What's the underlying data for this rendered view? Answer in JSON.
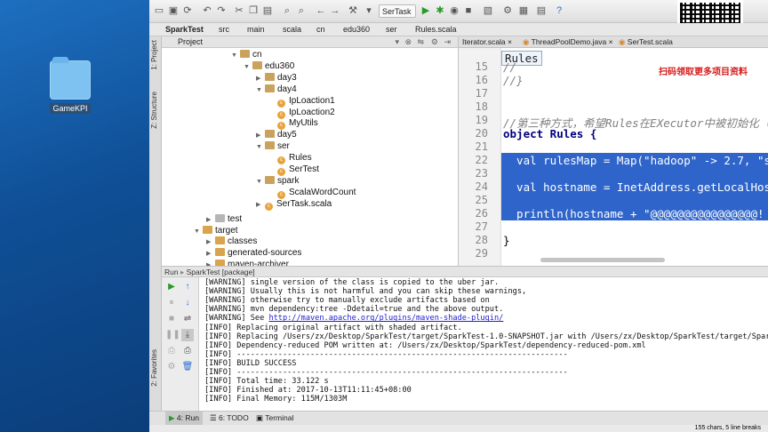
{
  "desktop": {
    "icon_label": "GameKPI"
  },
  "toolbar": {
    "run_config": "SerTask"
  },
  "overlay": {
    "qr_caption": "扫码领取更多项目资料"
  },
  "breadcrumb": [
    "SparkTest",
    "src",
    "main",
    "scala",
    "cn",
    "edu360",
    "ser",
    "Rules.scala"
  ],
  "editor_tabs": [
    "Iterator.scala",
    "ThreadPoolDemo.java",
    "SerTest.scala"
  ],
  "left_tabs": {
    "project": "1: Project",
    "structure": "Z: Structure",
    "favorites": "2: Favorites"
  },
  "project_panel": {
    "title": "Project"
  },
  "tree": [
    {
      "label": "cn",
      "kind": "folder",
      "arrow": "▼"
    },
    {
      "label": "edu360",
      "kind": "folder",
      "arrow": "▼"
    },
    {
      "label": "day3",
      "kind": "folder",
      "arrow": "▶"
    },
    {
      "label": "day4",
      "kind": "folder",
      "arrow": "▼"
    },
    {
      "label": "IpLoaction1",
      "kind": "class",
      "arrow": ""
    },
    {
      "label": "IpLoaction2",
      "kind": "class",
      "arrow": ""
    },
    {
      "label": "MyUtils",
      "kind": "class",
      "arrow": ""
    },
    {
      "label": "day5",
      "kind": "folder",
      "arrow": "▶"
    },
    {
      "label": "ser",
      "kind": "folder",
      "arrow": "▼"
    },
    {
      "label": "Rules",
      "kind": "class",
      "arrow": ""
    },
    {
      "label": "SerTest",
      "kind": "class",
      "arrow": ""
    },
    {
      "label": "spark",
      "kind": "folder",
      "arrow": "▼"
    },
    {
      "label": "ScalaWordCount",
      "kind": "class",
      "arrow": ""
    },
    {
      "label": "SerTask.scala",
      "kind": "class",
      "arrow": "▶"
    },
    {
      "label": "test",
      "kind": "src",
      "arrow": "▶"
    },
    {
      "label": "target",
      "kind": "tgt",
      "arrow": "▼"
    },
    {
      "label": "classes",
      "kind": "tgt",
      "arrow": "▶"
    },
    {
      "label": "generated-sources",
      "kind": "tgt",
      "arrow": "▶"
    },
    {
      "label": "maven-archiver",
      "kind": "tgt",
      "arrow": "▶"
    }
  ],
  "editor": {
    "popup": "Rules",
    "line_numbers": [
      "15",
      "16",
      "17",
      "18",
      "19",
      "20",
      "21",
      "22",
      "23",
      "24",
      "25",
      "26",
      "27",
      "28",
      "29"
    ],
    "lines": [
      "//",
      "//}",
      "",
      "",
      "//第三种方式，希望Rules在EXecutor中被初始化（不",
      "object Rules {",
      "",
      "  val rulesMap = Map(\"hadoop\" -> 2.7, \"s",
      "",
      "  val hostname = InetAddress.getLocalHos",
      "",
      "  println(hostname + \"@@@@@@@@@@@@@@@@! ",
      "",
      "}",
      ""
    ]
  },
  "run": {
    "header_label": "Run",
    "header_target": "SparkTest [package]"
  },
  "console": [
    "[WARNING] single version of the class is copied to the uber jar.",
    "[WARNING] Usually this is not harmful and you can skip these warnings,",
    "[WARNING] otherwise try to manually exclude artifacts based on",
    "[WARNING] mvn dependency:tree -Ddetail=true and the above output.",
    "[WARNING] See ",
    "[INFO] Replacing original artifact with shaded artifact.",
    "[INFO] Replacing /Users/zx/Desktop/SparkTest/target/SparkTest-1.0-SNAPSHOT.jar with /Users/zx/Desktop/SparkTest/target/SparkTest-1.0-SNAPSHOT-shaded.jar",
    "[INFO] Dependency-reduced POM written at: /Users/zx/Desktop/SparkTest/dependency-reduced-pom.xml",
    "[INFO] ------------------------------------------------------------------------",
    "[INFO] BUILD SUCCESS",
    "[INFO] ------------------------------------------------------------------------",
    "[INFO] Total time: 33.122 s",
    "[INFO] Finished at: 2017-10-13T11:11:45+08:00",
    "[INFO] Final Memory: 115M/1303M"
  ],
  "console_link": "http://maven.apache.org/plugins/maven-shade-plugin/",
  "bottom_tabs": {
    "run": "4: Run",
    "todo": "6: TODO",
    "terminal": "Terminal"
  },
  "status": {
    "text": "155 chars, 5 line breaks"
  }
}
